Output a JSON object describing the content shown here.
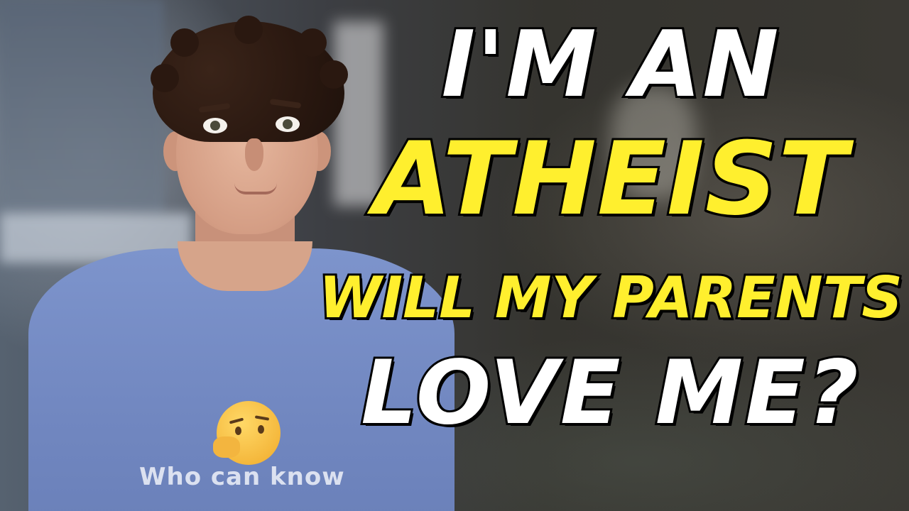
{
  "thumbnail": {
    "headline": {
      "line1": "I'M AN",
      "line2": "ATHEIST",
      "line3": "WILL MY PARENTS",
      "line4": "LOVE ME?"
    },
    "shirt_text": "Who can know",
    "emoji_icon": "thinking-face-icon",
    "colors": {
      "headline_white": "#ffffff",
      "headline_yellow": "#ffef2e",
      "outline": "#000000",
      "shirt": "#7187c0"
    }
  }
}
